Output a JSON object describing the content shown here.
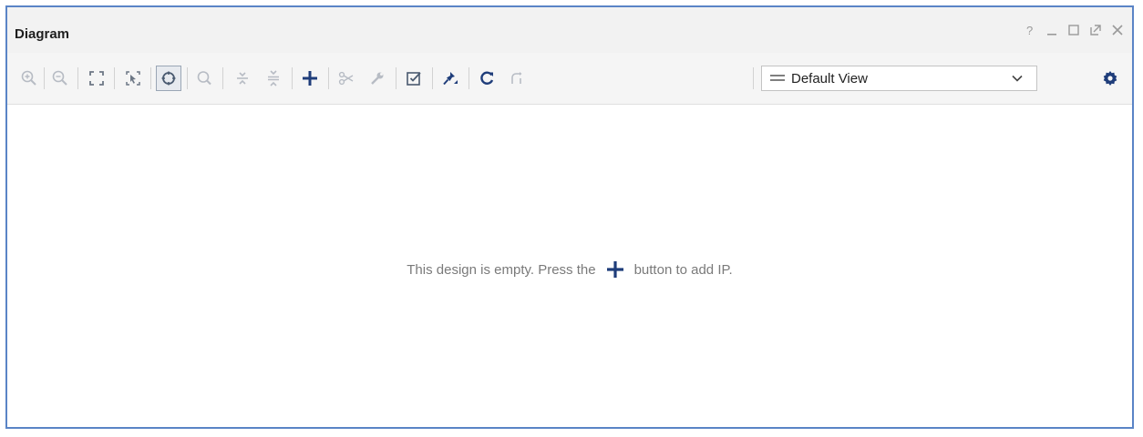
{
  "window": {
    "title": "Diagram",
    "controls": [
      "help-icon",
      "minimize-icon",
      "maximize-icon",
      "float-icon",
      "close-icon"
    ]
  },
  "toolbar": {
    "view_select": {
      "selected": "Default View"
    },
    "buttons": [
      "zoom-in-icon",
      "zoom-out-icon",
      "zoom-fit-icon",
      "zoom-area-icon",
      "selection-mode-icon",
      "search-icon",
      "expand-all-icon",
      "collapse-all-icon",
      "add-ip-icon",
      "cut-icon",
      "customize-icon",
      "validate-design-icon",
      "pin-icon",
      "regenerate-layout-icon",
      "optimize-routing-icon",
      "settings-icon"
    ]
  },
  "canvas": {
    "empty_text_before": "This design is empty. Press the",
    "empty_text_after": "button to add IP."
  },
  "colors": {
    "frame_border": "#5a84c6",
    "accent": "#1f3d7a",
    "disabled_icon": "#b7bcc4"
  }
}
